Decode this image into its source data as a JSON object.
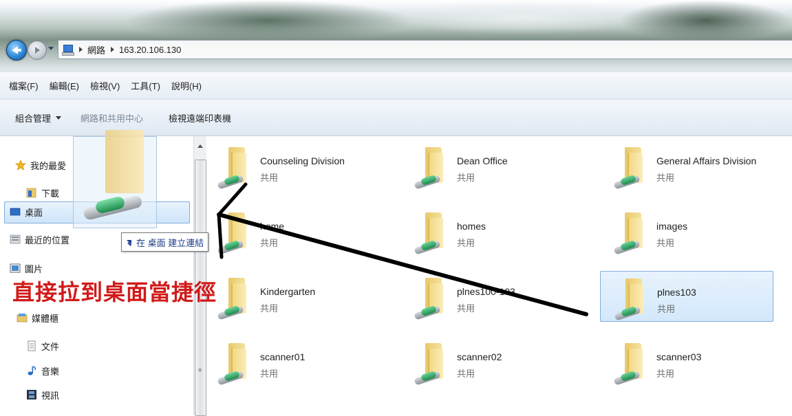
{
  "address": {
    "crumbs": [
      "網路",
      "163.20.106.130"
    ]
  },
  "menu": [
    "檔案(F)",
    "編輯(E)",
    "檢視(V)",
    "工具(T)",
    "說明(H)"
  ],
  "toolbar": {
    "organize": "組合管理",
    "network_center": "網路和共用中心",
    "printers": "檢視遠端印表機"
  },
  "nav": {
    "favorites": "我的最愛",
    "downloads": "下載",
    "desktop": "桌面",
    "recent": "最近的位置",
    "pictures": "圖片",
    "libraries": "媒體櫃",
    "documents": "文件",
    "music": "音樂",
    "videos": "視訊"
  },
  "folders": [
    {
      "name": "Counseling Division",
      "sub": "共用"
    },
    {
      "name": "Dean Office",
      "sub": "共用"
    },
    {
      "name": "General Affairs Division",
      "sub": "共用"
    },
    {
      "name": "home",
      "sub": "共用"
    },
    {
      "name": "homes",
      "sub": "共用"
    },
    {
      "name": "images",
      "sub": "共用"
    },
    {
      "name": "Kindergarten",
      "sub": "共用"
    },
    {
      "name": "plnes100-103",
      "sub": "共用"
    },
    {
      "name": "plnes103",
      "sub": "共用"
    },
    {
      "name": "scanner01",
      "sub": "共用"
    },
    {
      "name": "scanner02",
      "sub": "共用"
    },
    {
      "name": "scanner03",
      "sub": "共用"
    }
  ],
  "drag_tooltip": "在 桌面 建立連結",
  "annotation": "直接拉到桌面當捷徑",
  "colors": {
    "annotation": "#d11a1a",
    "selection": "#cfe5fa",
    "tooltip_text": "#1c3f8a"
  }
}
